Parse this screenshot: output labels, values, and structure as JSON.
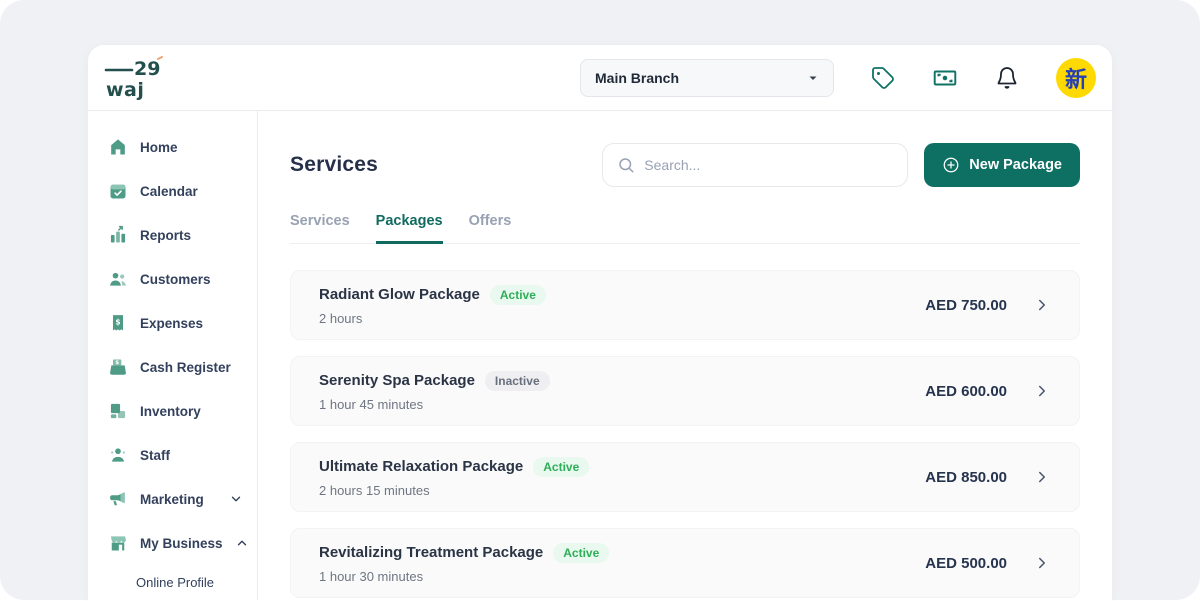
{
  "brand": {
    "logo_line1": "29",
    "logo_line2": "waj"
  },
  "topbar": {
    "branch_selector": {
      "value": "Main Branch"
    },
    "icons": [
      "tag-icon",
      "banknote-icon",
      "bell-icon"
    ],
    "avatar_text": "新"
  },
  "sidebar": {
    "items": [
      {
        "label": "Home",
        "icon": "home-icon"
      },
      {
        "label": "Calendar",
        "icon": "calendar-icon"
      },
      {
        "label": "Reports",
        "icon": "reports-icon"
      },
      {
        "label": "Customers",
        "icon": "customers-icon"
      },
      {
        "label": "Expenses",
        "icon": "expenses-icon"
      },
      {
        "label": "Cash Register",
        "icon": "cash-register-icon"
      },
      {
        "label": "Inventory",
        "icon": "inventory-icon"
      },
      {
        "label": "Staff",
        "icon": "staff-icon"
      },
      {
        "label": "Marketing",
        "icon": "marketing-icon",
        "chevron": "down"
      },
      {
        "label": "My Business",
        "icon": "my-business-icon",
        "chevron": "up"
      }
    ],
    "sub_items": [
      {
        "label": "Online Profile"
      }
    ]
  },
  "main": {
    "title": "Services",
    "search": {
      "placeholder": "Search..."
    },
    "new_package_button": "New Package",
    "tabs": [
      {
        "label": "Services",
        "active": false
      },
      {
        "label": "Packages",
        "active": true
      },
      {
        "label": "Offers",
        "active": false
      }
    ],
    "packages": [
      {
        "name": "Radiant Glow Package",
        "status": "Active",
        "duration": "2 hours",
        "price": "AED 750.00"
      },
      {
        "name": "Serenity Spa Package",
        "status": "Inactive",
        "duration": "1 hour 45 minutes",
        "price": "AED 600.00"
      },
      {
        "name": "Ultimate Relaxation Package",
        "status": "Active",
        "duration": "2 hours 15 minutes",
        "price": "AED 850.00"
      },
      {
        "name": "Revitalizing Treatment Package",
        "status": "Active",
        "duration": "1 hour 30 minutes",
        "price": "AED 500.00"
      }
    ]
  },
  "colors": {
    "primary_teal": "#0e6f63",
    "logo_teal": "#234f4d",
    "sidebar_icon_green": "#4f9c86",
    "active_badge_green": "#2fae59",
    "avatar_bg": "#ffd902",
    "avatar_fg": "#2440b3"
  }
}
